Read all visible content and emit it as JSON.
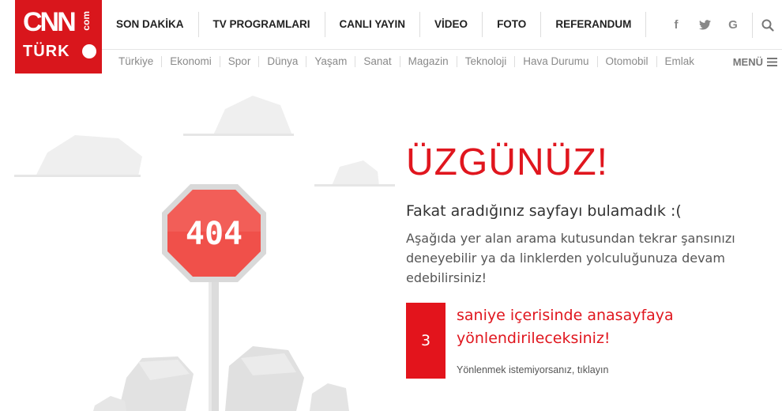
{
  "header": {
    "logo": {
      "top": "CNN",
      "side": "com",
      "bottom": "TÜRK"
    },
    "nav": [
      {
        "label": "SON DAKİKA"
      },
      {
        "label": "TV PROGRAMLARI"
      },
      {
        "label": "CANLI YAYIN"
      },
      {
        "label": "VİDEO"
      },
      {
        "label": "FOTO"
      },
      {
        "label": "REFERANDUM"
      }
    ],
    "social": [
      {
        "icon": "facebook-icon",
        "glyph": "f"
      },
      {
        "icon": "twitter-icon",
        "glyph": ""
      },
      {
        "icon": "google-icon",
        "glyph": "G"
      }
    ],
    "subnav": [
      {
        "label": "Türkiye"
      },
      {
        "label": "Ekonomi"
      },
      {
        "label": "Spor"
      },
      {
        "label": "Dünya"
      },
      {
        "label": "Yaşam"
      },
      {
        "label": "Sanat"
      },
      {
        "label": "Magazin"
      },
      {
        "label": "Teknoloji"
      },
      {
        "label": "Hava Durumu"
      },
      {
        "label": "Otomobil"
      },
      {
        "label": "Emlak"
      }
    ],
    "menu_label": "MENÜ"
  },
  "illustration": {
    "sign_text": "404"
  },
  "error": {
    "title": "ÜZGÜNÜZ!",
    "subtitle": "Fakat aradığınız sayfayı bulamadık :(",
    "description": "Aşağıda yer alan arama kutusundan tekrar şansınızı deneyebilir ya da linklerden yolculuğunuza devam edebilirsiniz!",
    "countdown": "3",
    "redirect_text": "saniye içerisinde anasayfaya yönlendirileceksiniz!",
    "cancel_link": "Yönlenmek istemiyorsanız, tıklayın"
  },
  "colors": {
    "brand_red": "#d9161c",
    "sign_red": "#f0504a",
    "cloud_gray": "#eeeeee",
    "rock_gray": "#e4e4e4"
  }
}
